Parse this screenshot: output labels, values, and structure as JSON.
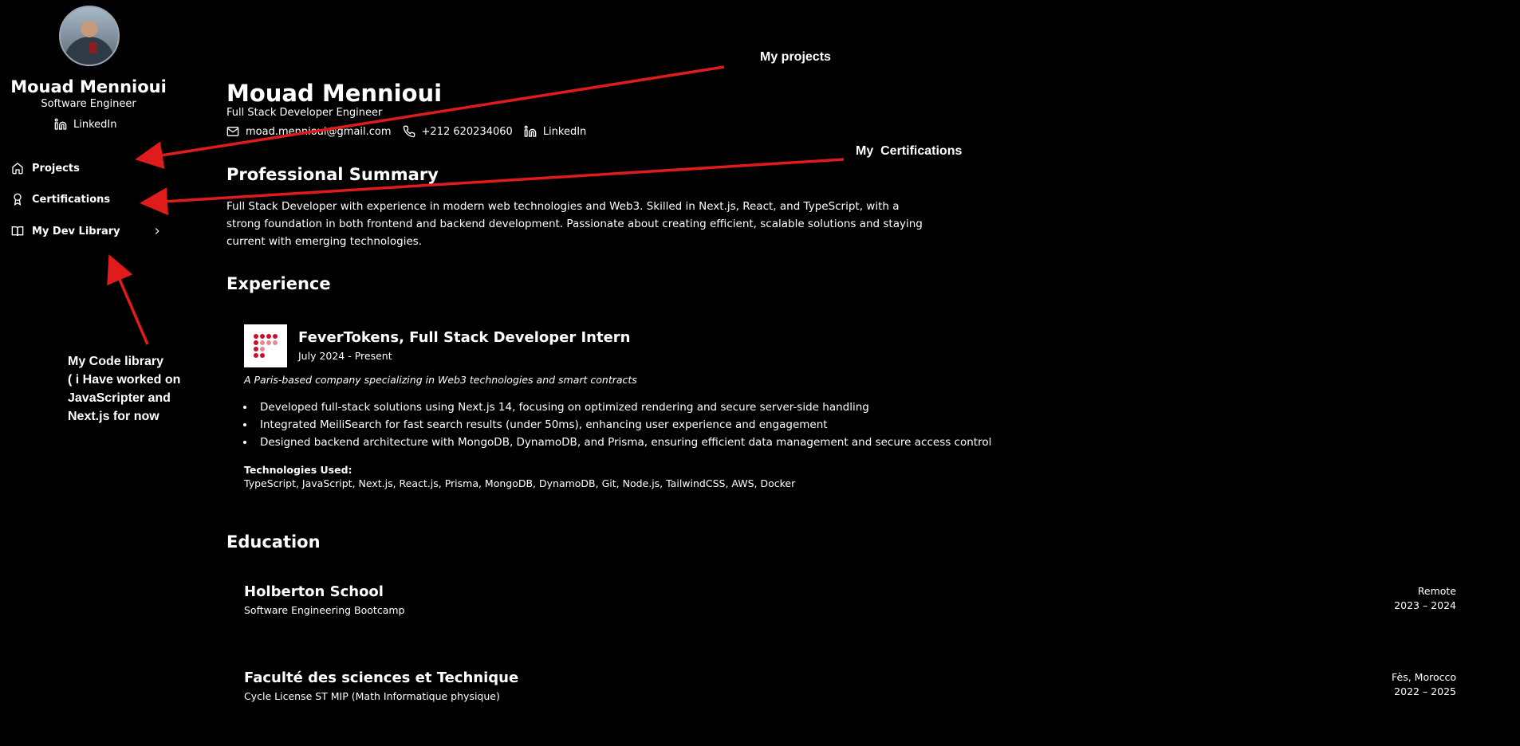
{
  "sidebar": {
    "name": "Mouad Mennioui",
    "role": "Software Engineer",
    "linkedin": "LinkedIn",
    "nav": [
      {
        "label": "Projects",
        "icon": "home-icon"
      },
      {
        "label": "Certifications",
        "icon": "award-icon"
      },
      {
        "label": "My Dev Library",
        "icon": "book-icon"
      }
    ]
  },
  "header": {
    "name": "Mouad Mennioui",
    "title": "Full Stack Developer Engineer",
    "email": "moad.mennioui@gmail.com",
    "phone": "+212 620234060",
    "linkedin": "LinkedIn"
  },
  "summary": {
    "heading": "Professional Summary",
    "text": "Full Stack Developer with experience in modern web technologies and Web3. Skilled in Next.js, React, and TypeScript, with a strong foundation in both frontend and backend development. Passionate about creating efficient, scalable solutions and staying current with emerging technologies."
  },
  "experience": {
    "heading": "Experience",
    "title": "FeverTokens, Full Stack Developer Intern",
    "date": "July 2024 - Present",
    "description": "A Paris-based company specializing in Web3 technologies and smart contracts",
    "bullets": [
      "Developed full-stack solutions using Next.js 14, focusing on optimized rendering and secure server-side handling",
      "Integrated MeiliSearch for fast search results (under 50ms), enhancing user experience and engagement",
      "Designed backend architecture with MongoDB, DynamoDB, and Prisma, ensuring efficient data management and secure access control"
    ],
    "tech_label": "Technologies Used:",
    "tech_list": "TypeScript, JavaScript, Next.js, React.js, Prisma, MongoDB, DynamoDB, Git, Node.js, TailwindCSS, AWS, Docker"
  },
  "education": {
    "heading": "Education",
    "items": [
      {
        "school": "Holberton School",
        "program": "Software Engineering Bootcamp",
        "location": "Remote",
        "years": "2023 – 2024"
      },
      {
        "school": "Faculté des sciences et Technique",
        "program": "Cycle License ST MIP (Math Informatique physique)",
        "location": "Fès, Morocco",
        "years": "2022 – 2025"
      }
    ]
  },
  "annotations": {
    "projects": "My projects",
    "certifications": "My  Certifications",
    "library_lines": [
      "My Code library",
      "( i Have worked on",
      "JavaScripter and",
      "Next.js for now"
    ]
  },
  "colors": {
    "background": "#000000",
    "text": "#ffffff",
    "annotation_arrow": "#e01b1b",
    "logo_red": "#c8102e"
  }
}
